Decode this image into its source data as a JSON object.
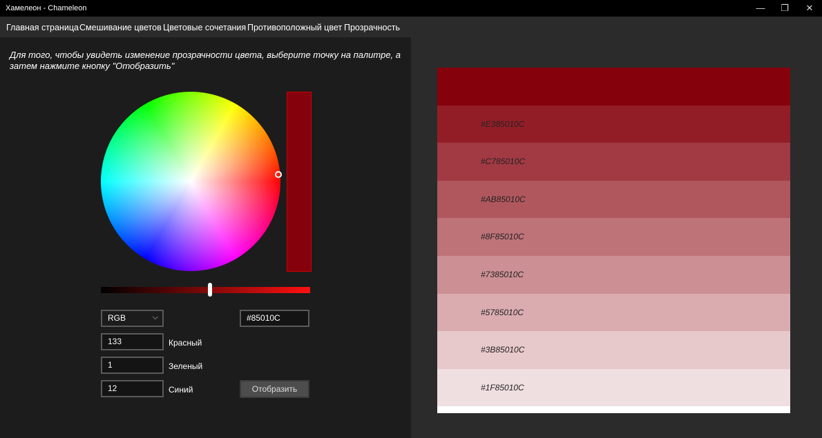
{
  "window": {
    "title": "Хамелеон - Chameleon",
    "minimize_label": "—",
    "maximize_label": "❐",
    "close_label": "✕"
  },
  "tabs": [
    {
      "label": "Главная страница"
    },
    {
      "label": "Смешивание цветов"
    },
    {
      "label": "Цветовые сочетания"
    },
    {
      "label": "Противоположный цвет"
    },
    {
      "label": "Прозрачность",
      "active": true
    }
  ],
  "instruction": "Для того, чтобы увидеть изменение прозрачности цвета, выберите точку на палитре, а затем нажмите кнопку \"Отобразить\"",
  "picker": {
    "selected_color": "#85010C",
    "alpha_slider_fraction": 0.52
  },
  "controls": {
    "mode_select": "RGB",
    "hex_value": "#85010C",
    "red_value": "133",
    "red_label": "Красный",
    "green_value": "1",
    "green_label": "Зеленый",
    "blue_value": "12",
    "blue_label": "Синий",
    "show_button": "Отобразить"
  },
  "palette": {
    "base_color": "#85010c",
    "bands": [
      {
        "label": "",
        "color": "#85010c"
      },
      {
        "label": "#E385010C",
        "color": "#931d27"
      },
      {
        "label": "#C785010C",
        "color": "#a23a43"
      },
      {
        "label": "#AB85010C",
        "color": "#b0575e"
      },
      {
        "label": "#8F85010C",
        "color": "#be7379"
      },
      {
        "label": "#7385010C",
        "color": "#cc9094"
      },
      {
        "label": "#5785010C",
        "color": "#daacb0"
      },
      {
        "label": "#3B85010C",
        "color": "#e8c9cb"
      },
      {
        "label": "#1F85010C",
        "color": "#f0dfe0"
      }
    ]
  }
}
